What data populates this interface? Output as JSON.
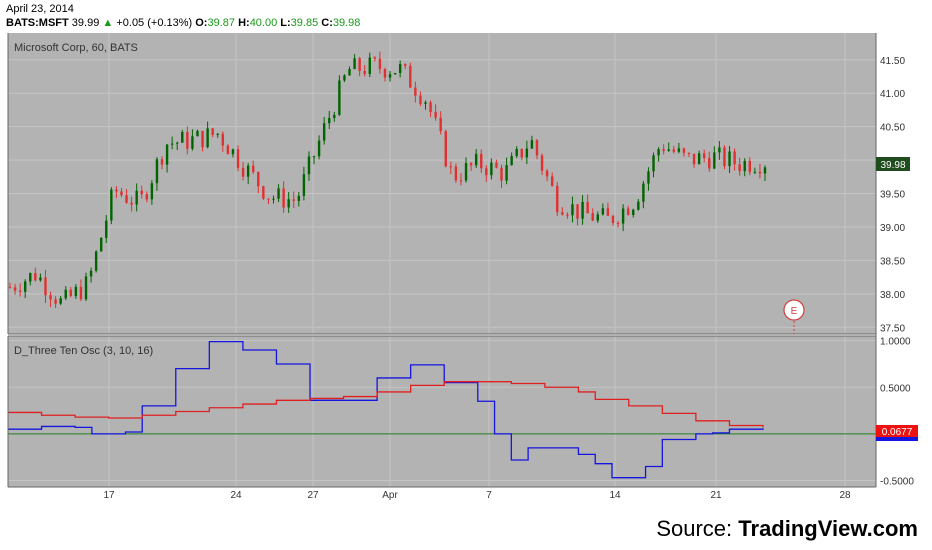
{
  "header": {
    "date": "April 23, 2014",
    "symbol": "BATS:MSFT",
    "last": "39.99",
    "change_arrow": "▲",
    "change": "+0.05 (+0.13%)",
    "open_label": "O:",
    "open": "39.87",
    "high_label": "H:",
    "high": "40.00",
    "low_label": "L:",
    "low": "39.85",
    "close_label": "C:",
    "close": "39.98"
  },
  "source": {
    "prefix": "Source:",
    "name": "TradingView.com"
  },
  "colors": {
    "background": "#b3b3b3",
    "grid": "#c4c4c4",
    "up_candle": "#006400",
    "down_candle": "#e03030",
    "fast_line": "#1515e0",
    "slow_line": "#e02020",
    "zero_line": "#208020",
    "price_tag": "#1f4d1f",
    "osc_tag": "#ee1111"
  },
  "chart_data": [
    {
      "type": "candlestick",
      "title": "Microsoft Corp, 60, BATS",
      "x_tick_labels": [
        "17",
        "24",
        "27",
        "Apr",
        "7",
        "14",
        "21",
        "28"
      ],
      "y_tick_labels": [
        "41.50",
        "41.00",
        "40.50",
        "40.00",
        "39.50",
        "39.00",
        "38.50",
        "38.00",
        "37.50"
      ],
      "ylim": [
        37.4,
        41.9
      ],
      "last_price_label": "39.98",
      "annotation": "E",
      "approx_close_by_session": [
        {
          "x": "Mar 12",
          "close": 38.1
        },
        {
          "x": "Mar 13",
          "close": 38.3
        },
        {
          "x": "Mar 14",
          "close": 37.85
        },
        {
          "x": "Mar 17",
          "close": 38.15
        },
        {
          "x": "Mar 18",
          "close": 39.55
        },
        {
          "x": "Mar 19",
          "close": 39.35
        },
        {
          "x": "Mar 20",
          "close": 40.25
        },
        {
          "x": "Mar 21",
          "close": 40.3
        },
        {
          "x": "Mar 24",
          "close": 40.4
        },
        {
          "x": "Mar 25",
          "close": 39.9
        },
        {
          "x": "Mar 26",
          "close": 39.45
        },
        {
          "x": "Mar 27",
          "close": 39.4
        },
        {
          "x": "Mar 28",
          "close": 40.4
        },
        {
          "x": "Mar 31",
          "close": 41.35
        },
        {
          "x": "Apr 1",
          "close": 41.4
        },
        {
          "x": "Apr 2",
          "close": 41.35
        },
        {
          "x": "Apr 3",
          "close": 40.9
        },
        {
          "x": "Apr 4",
          "close": 39.75
        },
        {
          "x": "Apr 7",
          "close": 39.95
        },
        {
          "x": "Apr 8",
          "close": 39.8
        },
        {
          "x": "Apr 9",
          "close": 40.3
        },
        {
          "x": "Apr 10",
          "close": 39.4
        },
        {
          "x": "Apr 11",
          "close": 39.2
        },
        {
          "x": "Apr 14",
          "close": 39.1
        },
        {
          "x": "Apr 15",
          "close": 39.4
        },
        {
          "x": "Apr 16",
          "close": 40.25
        },
        {
          "x": "Apr 17",
          "close": 40.0
        },
        {
          "x": "Apr 21",
          "close": 40.05
        },
        {
          "x": "Apr 22",
          "close": 39.95
        },
        {
          "x": "Apr 23",
          "close": 39.98
        }
      ]
    },
    {
      "type": "line",
      "title": "D_Three Ten Osc (3, 10, 16)",
      "x_tick_labels": [
        "17",
        "24",
        "27",
        "Apr",
        "7",
        "14",
        "21",
        "28"
      ],
      "y_tick_labels": [
        "1.0000",
        "0.5000",
        "-0.5000"
      ],
      "ylim": [
        -0.57,
        1.05
      ],
      "last_value_label": "0.0677",
      "zero_line": 0,
      "series": [
        {
          "color": "blue",
          "points": [
            [
              0,
              0.05
            ],
            [
              2,
              0.08
            ],
            [
              4,
              0.07
            ],
            [
              5,
              0.0
            ],
            [
              7,
              0.02
            ],
            [
              8,
              0.3
            ],
            [
              10,
              0.7
            ],
            [
              12,
              0.99
            ],
            [
              14,
              0.9
            ],
            [
              16,
              0.75
            ],
            [
              18,
              0.36
            ],
            [
              20,
              0.36
            ],
            [
              22,
              0.6
            ],
            [
              24,
              0.74
            ],
            [
              26,
              0.55
            ],
            [
              28,
              0.35
            ],
            [
              29,
              0.0
            ],
            [
              30,
              -0.28
            ],
            [
              31,
              -0.15
            ],
            [
              33,
              -0.15
            ],
            [
              34,
              -0.22
            ],
            [
              35,
              -0.32
            ],
            [
              36,
              -0.47
            ],
            [
              38,
              -0.35
            ],
            [
              39,
              -0.06
            ],
            [
              41,
              0.0
            ],
            [
              42,
              0.01
            ],
            [
              43,
              0.05
            ],
            [
              45,
              0.06
            ]
          ]
        },
        {
          "color": "red",
          "points": [
            [
              0,
              0.23
            ],
            [
              2,
              0.2
            ],
            [
              4,
              0.18
            ],
            [
              6,
              0.17
            ],
            [
              8,
              0.2
            ],
            [
              10,
              0.24
            ],
            [
              12,
              0.28
            ],
            [
              14,
              0.32
            ],
            [
              16,
              0.36
            ],
            [
              18,
              0.38
            ],
            [
              20,
              0.4
            ],
            [
              22,
              0.45
            ],
            [
              24,
              0.52
            ],
            [
              26,
              0.56
            ],
            [
              28,
              0.56
            ],
            [
              30,
              0.54
            ],
            [
              32,
              0.5
            ],
            [
              34,
              0.45
            ],
            [
              35,
              0.37
            ],
            [
              37,
              0.3
            ],
            [
              39,
              0.22
            ],
            [
              41,
              0.14
            ],
            [
              43,
              0.09
            ],
            [
              45,
              0.07
            ]
          ]
        }
      ]
    }
  ]
}
